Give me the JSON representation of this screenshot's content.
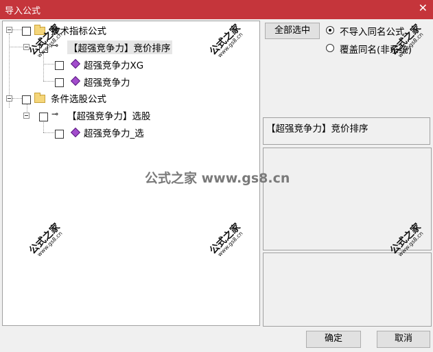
{
  "window": {
    "title": "导入公式",
    "close_icon": "close-icon"
  },
  "tree": {
    "nodes": [
      {
        "label": "技术指标公式"
      },
      {
        "label": "【超强竞争力】竞价排序"
      },
      {
        "label": "超强竞争力XG"
      },
      {
        "label": "超强竞争力"
      },
      {
        "label": "条件选股公式"
      },
      {
        "label": "【超强竞争力】选股"
      },
      {
        "label": "超强竞争力_选"
      }
    ]
  },
  "buttons": {
    "select_all": "全部选中",
    "ok": "确定",
    "cancel": "取消"
  },
  "options": {
    "no_import_same": "不导入同名公式",
    "overwrite_same": "覆盖同名(非系统)"
  },
  "info": {
    "selected_name": "【超强竞争力】竞价排序"
  },
  "watermark": {
    "main": "公式之家 www.gs8.cn",
    "stamp": "公式之家",
    "url": "www.gs8.cn"
  },
  "colors": {
    "titlebar": "#c5353b",
    "diamond": "#a24ccc",
    "folder": "#f5d67a"
  }
}
